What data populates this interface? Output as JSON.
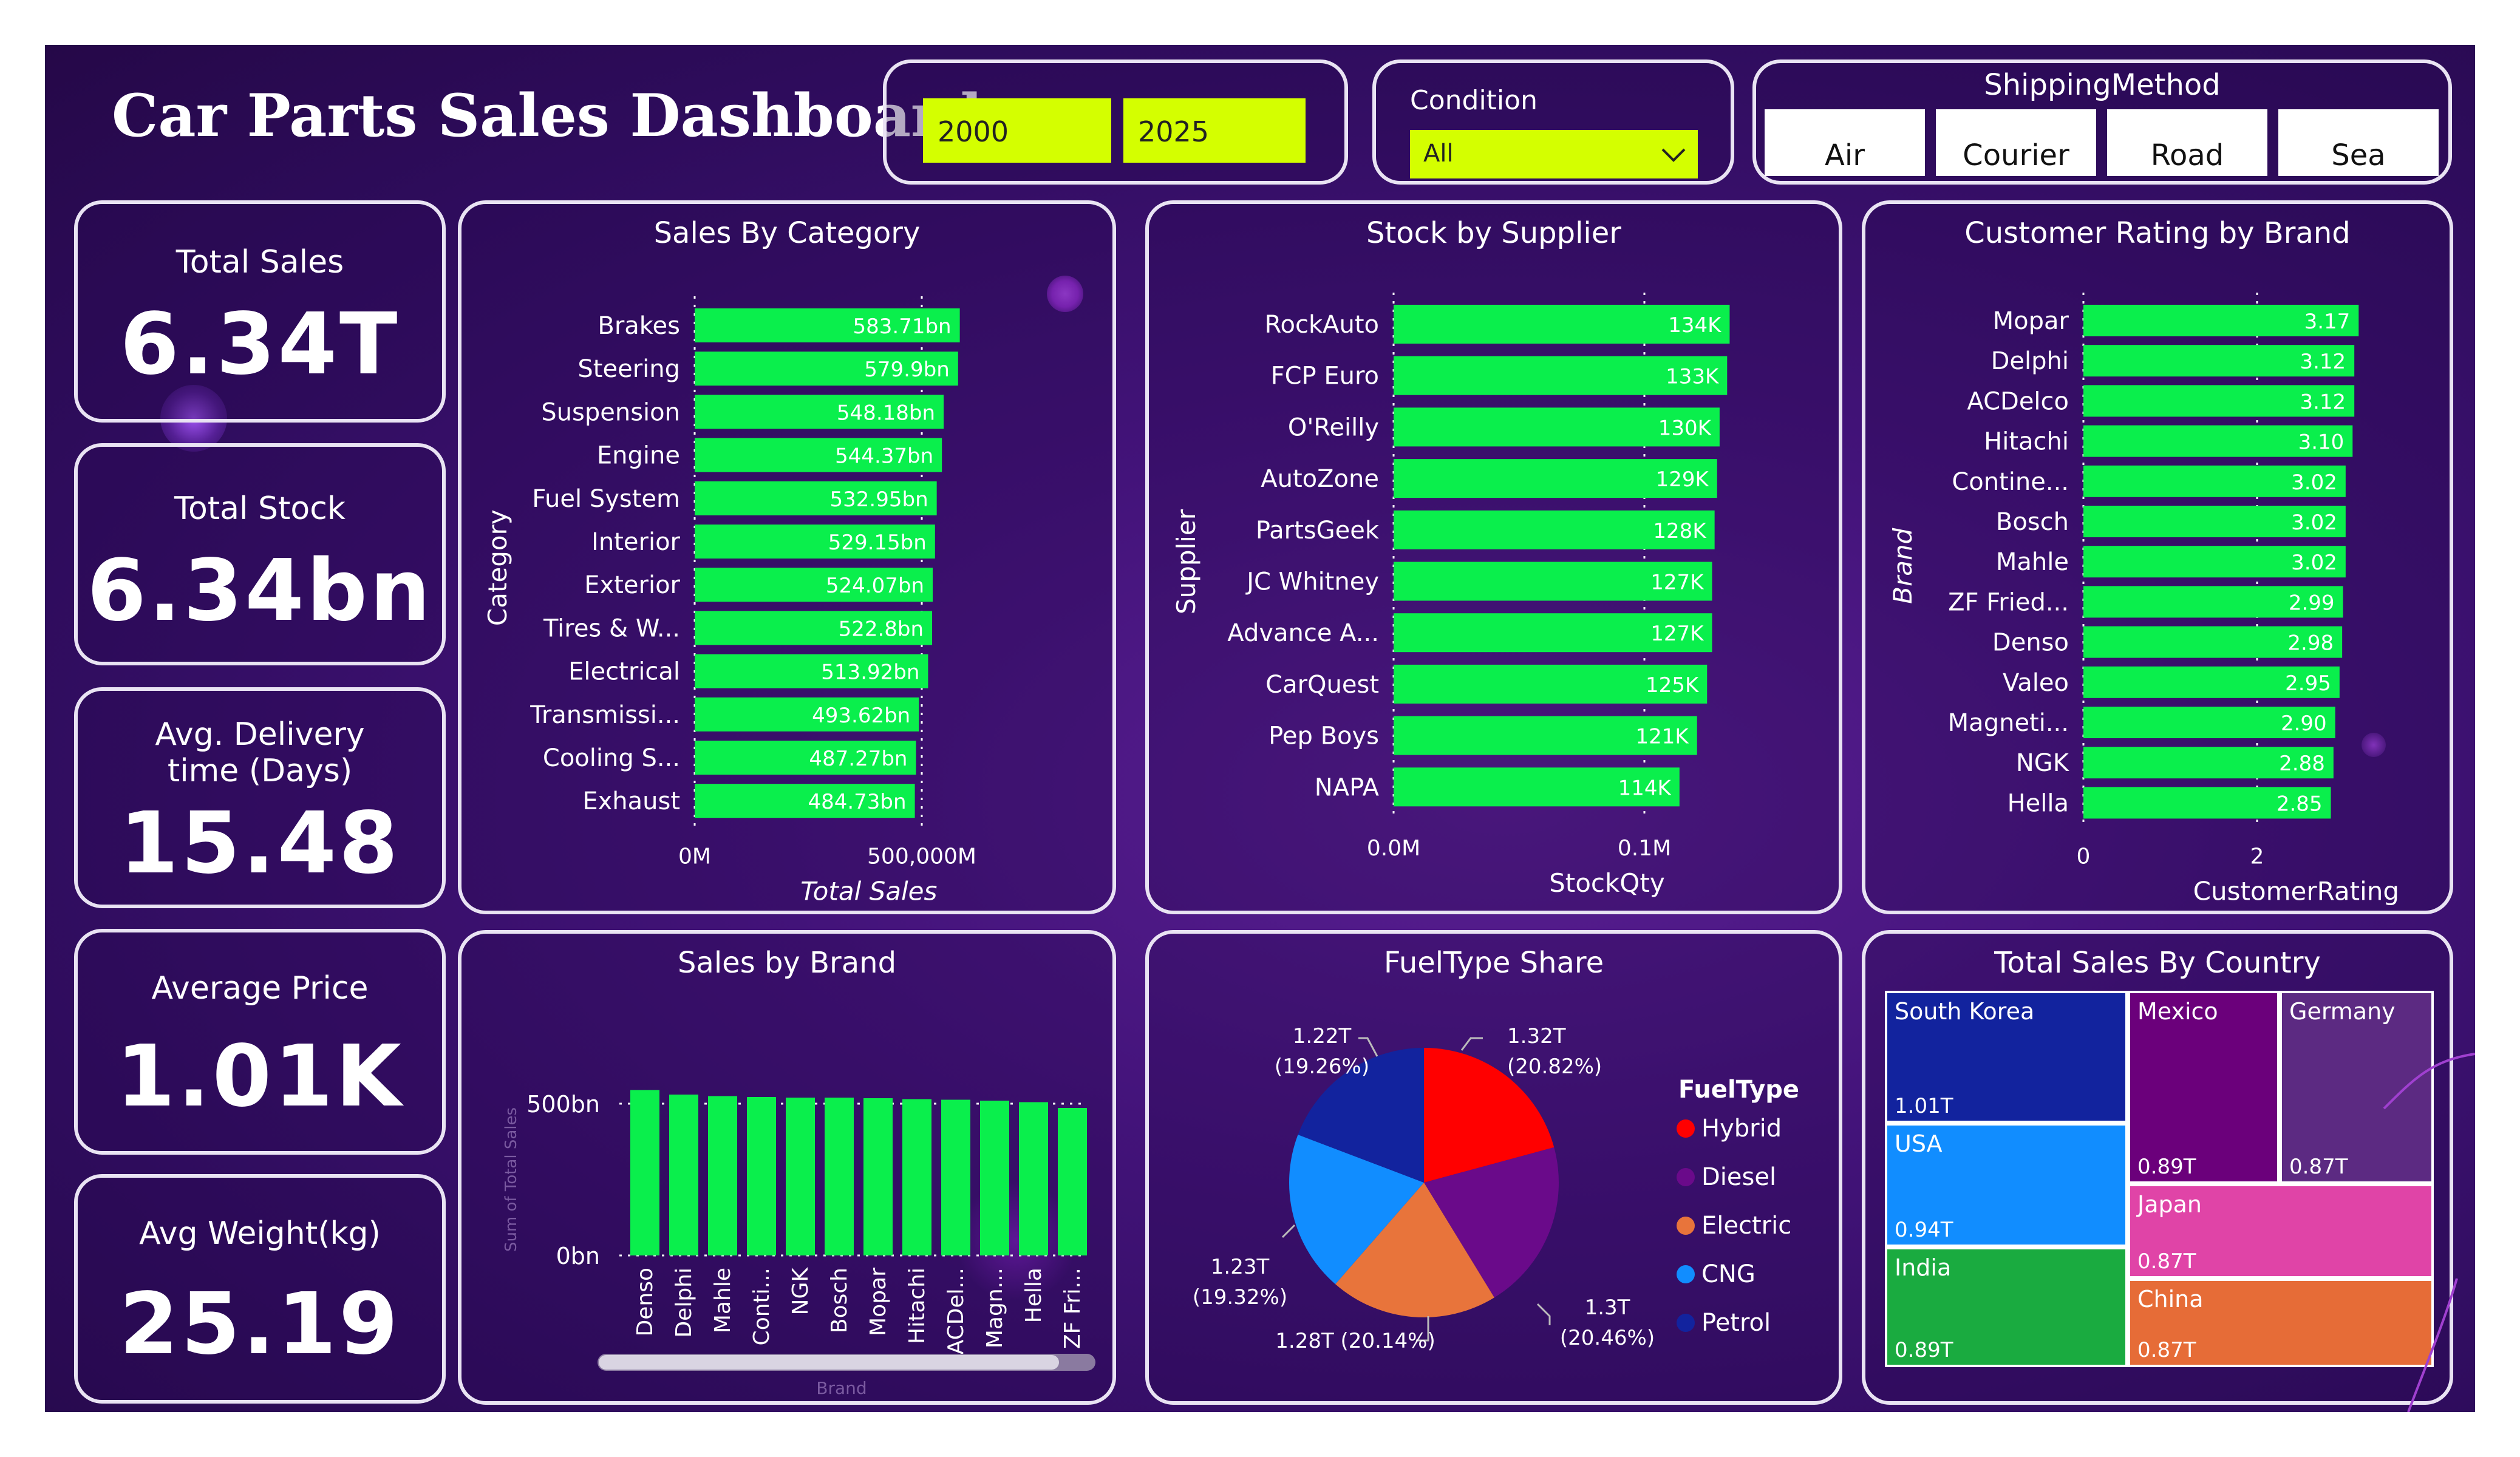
{
  "title": "Car Parts Sales Dashboard",
  "year_slicer": {
    "from": "2000",
    "to": "2025"
  },
  "condition_slicer": {
    "label": "Condition",
    "value": "All"
  },
  "shipping": {
    "label": "ShippingMethod",
    "options": [
      "Air",
      "Courier",
      "Road",
      "Sea"
    ]
  },
  "kpis": [
    {
      "label": "Total Sales",
      "value": "6.34T"
    },
    {
      "label": "Total Stock",
      "value": "6.34bn"
    },
    {
      "label": "Avg. Delivery time (Days)",
      "value": "15.48"
    },
    {
      "label": "Average Price",
      "value": "1.01K"
    },
    {
      "label": "Avg Weight(kg)",
      "value": "25.19"
    }
  ],
  "colors": {
    "bar": "#0aef4c",
    "slicer": "#d4ff00",
    "background": "#3a0f6e",
    "border": "#e9e3f3"
  },
  "chart_data": [
    {
      "id": "sales_by_category",
      "type": "bar",
      "orientation": "horizontal",
      "title": "Sales By Category",
      "ylabel": "Category",
      "xlabel": "Total Sales",
      "xticks": [
        "0M",
        "500,000M"
      ],
      "xlim": [
        0,
        700
      ],
      "unit_value_note": "bn",
      "categories": [
        "Brakes",
        "Steering",
        "Suspension",
        "Engine",
        "Fuel System",
        "Interior",
        "Exterior",
        "Tires & W...",
        "Electrical",
        "Transmissi...",
        "Cooling S...",
        "Exhaust"
      ],
      "values": [
        583.71,
        579.9,
        548.18,
        544.37,
        532.95,
        529.15,
        524.07,
        522.8,
        513.92,
        493.62,
        487.27,
        484.73
      ],
      "labels": [
        "583.71bn",
        "579.9bn",
        "548.18bn",
        "544.37bn",
        "532.95bn",
        "529.15bn",
        "524.07bn",
        "522.8bn",
        "513.92bn",
        "493.62bn",
        "487.27bn",
        "484.73bn"
      ]
    },
    {
      "id": "stock_by_supplier",
      "type": "bar",
      "orientation": "horizontal",
      "title": "Stock by Supplier",
      "ylabel": "Supplier",
      "xlabel": "StockQty",
      "xticks": [
        "0.0M",
        "0.1M"
      ],
      "xlim": [
        0,
        175
      ],
      "categories": [
        "RockAuto",
        "FCP Euro",
        "O'Reilly",
        "AutoZone",
        "PartsGeek",
        "JC Whitney",
        "Advance A...",
        "CarQuest",
        "Pep Boys",
        "NAPA"
      ],
      "values": [
        134,
        133,
        130,
        129,
        128,
        127,
        127,
        125,
        121,
        114
      ],
      "labels": [
        "134K",
        "133K",
        "130K",
        "129K",
        "128K",
        "127K",
        "127K",
        "125K",
        "121K",
        "114K"
      ]
    },
    {
      "id": "rating_by_brand",
      "type": "bar",
      "orientation": "horizontal",
      "title": "Customer Rating by Brand",
      "ylabel": "Brand",
      "xlabel": "CustomerRating",
      "xticks": [
        "0",
        "2"
      ],
      "xlim": [
        0,
        4.9
      ],
      "categories": [
        "Mopar",
        "Delphi",
        "ACDelco",
        "Hitachi",
        "Contine...",
        "Bosch",
        "Mahle",
        "ZF Fried...",
        "Denso",
        "Valeo",
        "Magneti...",
        "NGK",
        "Hella"
      ],
      "values": [
        3.17,
        3.12,
        3.12,
        3.1,
        3.02,
        3.02,
        3.02,
        2.99,
        2.98,
        2.95,
        2.9,
        2.88,
        2.85
      ],
      "labels": [
        "3.17",
        "3.12",
        "3.12",
        "3.10",
        "3.02",
        "3.02",
        "3.02",
        "2.99",
        "2.98",
        "2.95",
        "2.90",
        "2.88",
        "2.85"
      ]
    },
    {
      "id": "sales_by_brand",
      "type": "bar",
      "orientation": "vertical",
      "title": "Sales by Brand",
      "ylabel": "Sum of Total Sales",
      "xlabel": "Brand",
      "yticks": [
        "500bn",
        "0bn"
      ],
      "ylim": [
        0,
        500
      ],
      "categories": [
        "Denso",
        "Delphi",
        "Mahle",
        "Conti...",
        "NGK",
        "Bosch",
        "Mopar",
        "Hitachi",
        "ACDel...",
        "Magn...",
        "Hella",
        "ZF Fri..."
      ],
      "values": [
        545,
        530,
        525,
        522,
        520,
        520,
        518,
        515,
        513,
        510,
        505,
        486
      ]
    },
    {
      "id": "fueltype_share",
      "type": "pie",
      "title": "FuelType Share",
      "legend_title": "FuelType",
      "legend_position": "right",
      "slices": [
        {
          "name": "Hybrid",
          "value": 1.32,
          "label": "1.32T",
          "pct": "(20.82%)",
          "color": "#ff0000"
        },
        {
          "name": "Diesel",
          "value": 1.3,
          "label": "1.3T",
          "pct": "(20.46%)",
          "color": "#6a0a8a"
        },
        {
          "name": "Electric",
          "value": 1.28,
          "label": "1.28T (20.14%)",
          "pct": "",
          "color": "#e8743b"
        },
        {
          "name": "CNG",
          "value": 1.23,
          "label": "1.23T",
          "pct": "(19.32%)",
          "color": "#118dff"
        },
        {
          "name": "Petrol",
          "value": 1.22,
          "label": "1.22T",
          "pct": "(19.26%)",
          "color": "#12239e"
        }
      ]
    },
    {
      "id": "sales_by_country",
      "type": "treemap",
      "title": "Total Sales By Country",
      "items": [
        {
          "name": "South Korea",
          "value": "1.01T",
          "color": "#12239e"
        },
        {
          "name": "USA",
          "value": "0.94T",
          "color": "#118dff"
        },
        {
          "name": "India",
          "value": "0.89T",
          "color": "#1aab40"
        },
        {
          "name": "Mexico",
          "value": "0.89T",
          "color": "#6b007b"
        },
        {
          "name": "Germany",
          "value": "0.87T",
          "color": "#5c2a82"
        },
        {
          "name": "Japan",
          "value": "0.87T",
          "color": "#e044a7"
        },
        {
          "name": "China",
          "value": "0.87T",
          "color": "#e66c37"
        }
      ]
    }
  ]
}
